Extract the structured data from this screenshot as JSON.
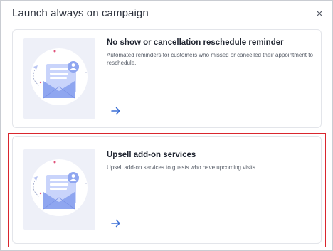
{
  "dialog": {
    "title": "Launch always on campaign",
    "close_icon": "close-icon"
  },
  "campaigns": [
    {
      "title": "No show or cancellation reschedule reminder",
      "description": "Automated reminders for customers who missed or cancelled their appointment to reschedule.",
      "illustration": "envelope-user-illustration",
      "action_icon": "arrow-right-icon"
    },
    {
      "title": "Upsell add-on services",
      "description": "Upsell add-on services to guests who have upcoming visits",
      "illustration": "envelope-user-illustration",
      "action_icon": "arrow-right-icon",
      "highlighted": true
    }
  ],
  "colors": {
    "highlight_border": "#d9262e",
    "arrow": "#3b6fd6",
    "envelope": "#8fa6f0",
    "illustration_bg": "#eef0f8"
  }
}
